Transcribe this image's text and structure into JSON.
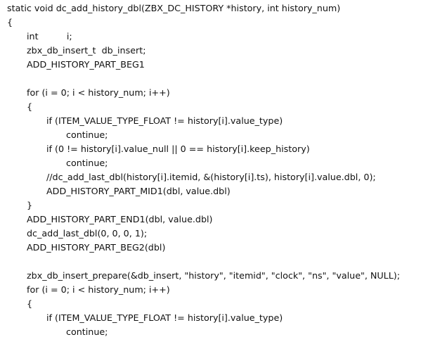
{
  "document": {
    "lines": [
      {
        "indent": 0,
        "text": "static void dc_add_history_dbl(ZBX_DC_HISTORY *history, int history_num)"
      },
      {
        "indent": 0,
        "text": "{"
      },
      {
        "indent": 1,
        "text": "int          i;"
      },
      {
        "indent": 1,
        "text": "zbx_db_insert_t  db_insert;"
      },
      {
        "indent": 1,
        "text": "ADD_HISTORY_PART_BEG1"
      },
      {
        "indent": 0,
        "text": ""
      },
      {
        "indent": 1,
        "text": "for (i = 0; i < history_num; i++)"
      },
      {
        "indent": 1,
        "text": "{"
      },
      {
        "indent": 2,
        "text": "if (ITEM_VALUE_TYPE_FLOAT != history[i].value_type)"
      },
      {
        "indent": 3,
        "text": "continue;"
      },
      {
        "indent": 2,
        "text": "if (0 != history[i].value_null || 0 == history[i].keep_history)"
      },
      {
        "indent": 3,
        "text": "continue;"
      },
      {
        "indent": 2,
        "text": "//dc_add_last_dbl(history[i].itemid, &(history[i].ts), history[i].value.dbl, 0);"
      },
      {
        "indent": 2,
        "text": "ADD_HISTORY_PART_MID1(dbl, value.dbl)"
      },
      {
        "indent": 1,
        "text": "}"
      },
      {
        "indent": 1,
        "text": "ADD_HISTORY_PART_END1(dbl, value.dbl)"
      },
      {
        "indent": 1,
        "text": "dc_add_last_dbl(0, 0, 0, 1);"
      },
      {
        "indent": 1,
        "text": "ADD_HISTORY_PART_BEG2(dbl)"
      },
      {
        "indent": 0,
        "text": ""
      },
      {
        "indent": 1,
        "text": "zbx_db_insert_prepare(&db_insert, \"history\", \"itemid\", \"clock\", \"ns\", \"value\", NULL);"
      },
      {
        "indent": 1,
        "text": "for (i = 0; i < history_num; i++)"
      },
      {
        "indent": 1,
        "text": "{"
      },
      {
        "indent": 2,
        "text": "if (ITEM_VALUE_TYPE_FLOAT != history[i].value_type)"
      },
      {
        "indent": 3,
        "text": "continue;"
      }
    ]
  }
}
